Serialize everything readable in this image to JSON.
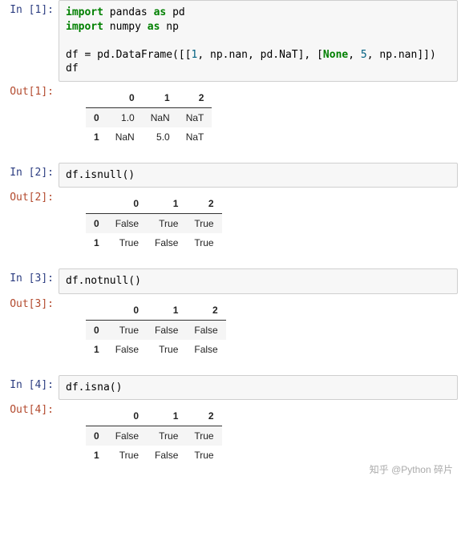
{
  "cells": [
    {
      "in_prompt": "In  [1]:",
      "code_tokens": [
        {
          "t": "import ",
          "c": "imp"
        },
        {
          "t": "pandas ",
          "c": "nn"
        },
        {
          "t": "as ",
          "c": "imp"
        },
        {
          "t": "pd",
          "c": "nn"
        },
        {
          "t": "\n",
          "c": ""
        },
        {
          "t": "import ",
          "c": "imp"
        },
        {
          "t": "numpy ",
          "c": "nn"
        },
        {
          "t": "as ",
          "c": "imp"
        },
        {
          "t": "np",
          "c": "nn"
        },
        {
          "t": "\n",
          "c": ""
        },
        {
          "t": "\n",
          "c": ""
        },
        {
          "t": "df ",
          "c": "nn"
        },
        {
          "t": "= ",
          "c": "nn"
        },
        {
          "t": "pd.DataFrame([[",
          "c": "nn"
        },
        {
          "t": "1",
          "c": "num"
        },
        {
          "t": ", np.nan, pd.NaT], [",
          "c": "nn"
        },
        {
          "t": "None",
          "c": "bln"
        },
        {
          "t": ", ",
          "c": "nn"
        },
        {
          "t": "5",
          "c": "num"
        },
        {
          "t": ", np.nan]])",
          "c": "nn"
        },
        {
          "t": "\n",
          "c": ""
        },
        {
          "t": "df",
          "c": "nn"
        }
      ],
      "out_prompt": "Out[1]:",
      "table": {
        "columns": [
          "0",
          "1",
          "2"
        ],
        "index": [
          "0",
          "1"
        ],
        "rows": [
          [
            "1.0",
            "NaN",
            "NaT"
          ],
          [
            "NaN",
            "5.0",
            "NaT"
          ]
        ]
      }
    },
    {
      "in_prompt": "In  [2]:",
      "code_tokens": [
        {
          "t": "df.isnull()",
          "c": "nn"
        }
      ],
      "out_prompt": "Out[2]:",
      "table": {
        "columns": [
          "0",
          "1",
          "2"
        ],
        "index": [
          "0",
          "1"
        ],
        "rows": [
          [
            "False",
            "True",
            "True"
          ],
          [
            "True",
            "False",
            "True"
          ]
        ]
      }
    },
    {
      "in_prompt": "In  [3]:",
      "code_tokens": [
        {
          "t": "df.notnull()",
          "c": "nn"
        }
      ],
      "out_prompt": "Out[3]:",
      "table": {
        "columns": [
          "0",
          "1",
          "2"
        ],
        "index": [
          "0",
          "1"
        ],
        "rows": [
          [
            "True",
            "False",
            "False"
          ],
          [
            "False",
            "True",
            "False"
          ]
        ]
      }
    },
    {
      "in_prompt": "In  [4]:",
      "code_tokens": [
        {
          "t": "df.isna()",
          "c": "nn"
        }
      ],
      "out_prompt": "Out[4]:",
      "table": {
        "columns": [
          "0",
          "1",
          "2"
        ],
        "index": [
          "0",
          "1"
        ],
        "rows": [
          [
            "False",
            "True",
            "True"
          ],
          [
            "True",
            "False",
            "True"
          ]
        ]
      }
    }
  ],
  "watermark": "知乎 @Python 碎片"
}
